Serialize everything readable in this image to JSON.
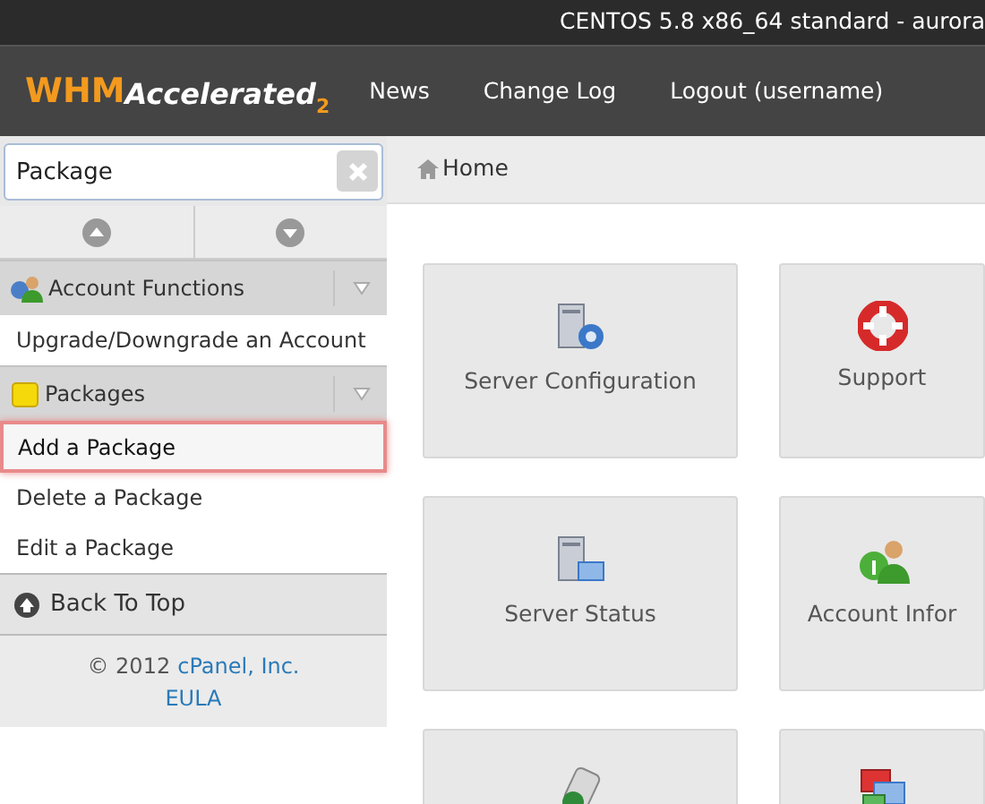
{
  "top_bar": {
    "title": "CENTOS 5.8 x86_64 standard - aurora"
  },
  "logo": {
    "brand": "WHM",
    "product": "Accelerated",
    "version": "2"
  },
  "nav": [
    "News",
    "Change Log",
    "Logout (username)"
  ],
  "search": {
    "value": "Package"
  },
  "breadcrumb": "Home",
  "sidebar": {
    "groups": [
      {
        "title": "Account Functions",
        "kind": "account",
        "items": [
          {
            "label": "Upgrade/Downgrade an Account",
            "selected": false
          }
        ]
      },
      {
        "title": "Packages",
        "kind": "folder",
        "items": [
          {
            "label": "Add a Package",
            "selected": true
          },
          {
            "label": "Delete a Package",
            "selected": false
          },
          {
            "label": "Edit a Package",
            "selected": false
          }
        ]
      }
    ],
    "back_to_top": "Back To Top",
    "footer": {
      "copyright": "© 2012",
      "company": "cPanel, Inc.",
      "eula": "EULA"
    }
  },
  "tiles": [
    {
      "label": "Server Configuration",
      "kind": "server-gear"
    },
    {
      "label": "Support",
      "kind": "lifebuoy"
    },
    {
      "label": "Server Status",
      "kind": "server-monitor"
    },
    {
      "label": "Account Infor",
      "kind": "user-info"
    },
    {
      "kind": "disk"
    },
    {
      "kind": "windows"
    }
  ]
}
